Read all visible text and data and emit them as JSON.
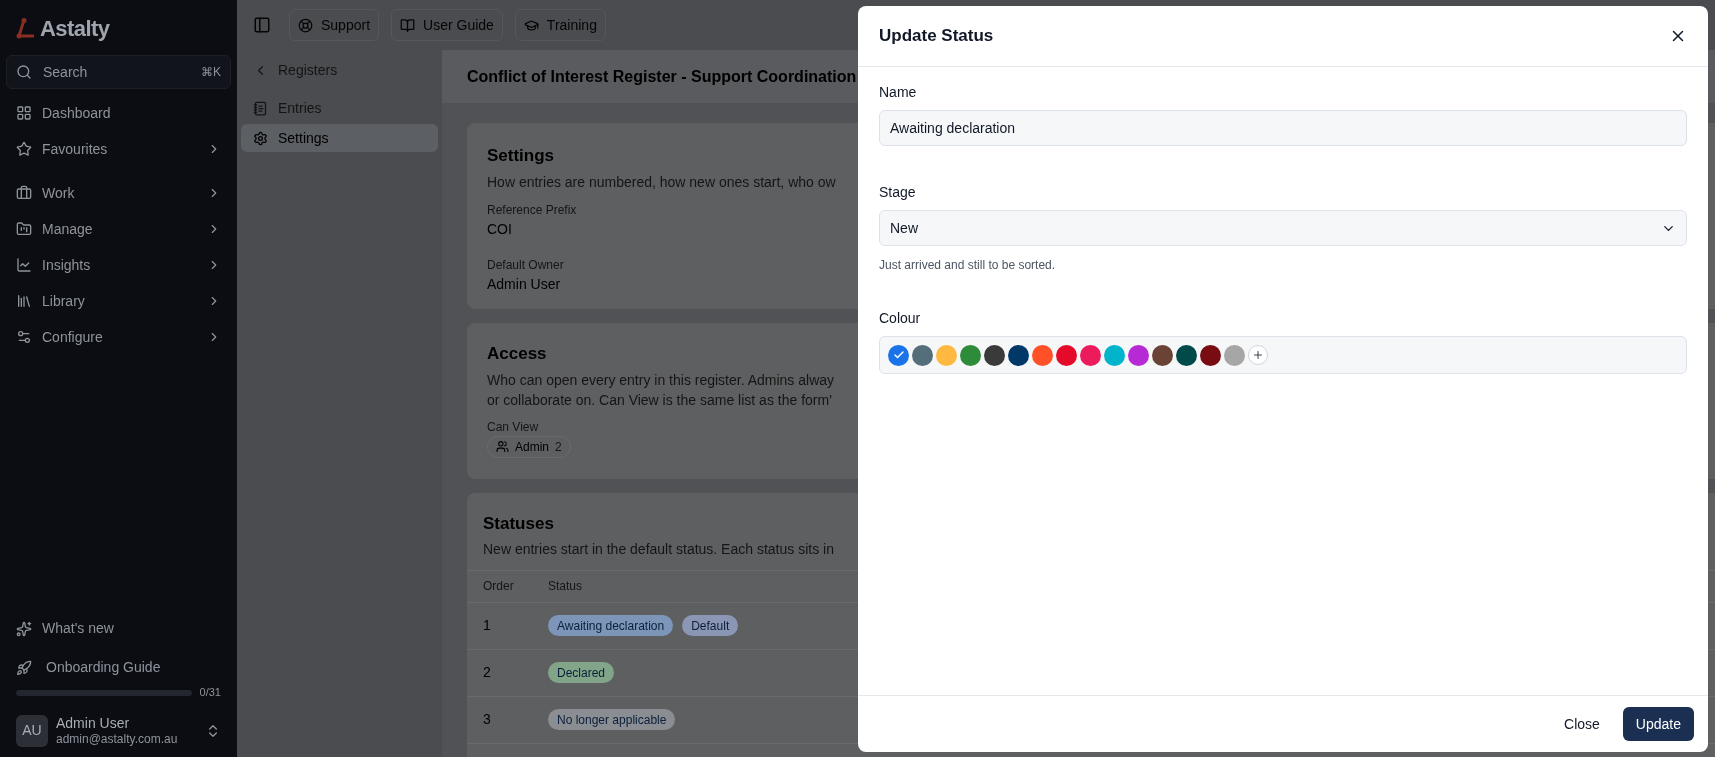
{
  "sidebar": {
    "logo": "Astalty",
    "search": {
      "placeholder": "Search",
      "shortcut": "⌘K"
    },
    "items": [
      {
        "kind": "link",
        "label": "Dashboard"
      },
      {
        "kind": "group",
        "label": "Favourites"
      },
      {
        "kind": "group",
        "label": "Work"
      },
      {
        "kind": "group",
        "label": "Manage"
      },
      {
        "kind": "group",
        "label": "Insights"
      },
      {
        "kind": "group",
        "label": "Library"
      },
      {
        "kind": "group",
        "label": "Configure"
      }
    ],
    "whats_new": "What's new",
    "onboarding": {
      "label": "Onboarding Guide",
      "level": 0,
      "count": "0/31"
    },
    "user": {
      "initials": "AU",
      "name": "Admin User",
      "email": "admin@astalty.com.au"
    }
  },
  "topbar": {
    "links": [
      "Support",
      "User Guide",
      "Training"
    ]
  },
  "register_nav": {
    "back": "Registers",
    "items": [
      {
        "label": "Entries",
        "selected": false
      },
      {
        "label": "Settings",
        "selected": true
      }
    ]
  },
  "page_title": "Conflict of Interest Register - Support Coordination",
  "settings_card": {
    "title": "Settings",
    "description": "How entries are numbered, how new ones start, who ow",
    "fields": [
      {
        "label": "Reference Prefix",
        "value": "COI"
      },
      {
        "label": "Default Owner",
        "value": "Admin User"
      }
    ]
  },
  "access_card": {
    "title": "Access",
    "description": "Who can open every entry in this register. Admins alway",
    "description_2": "or collaborate on. Can View is the same list as the form'",
    "can_view_label": "Can View",
    "group": {
      "name": "Admin",
      "count": "2"
    }
  },
  "statuses_card": {
    "title": "Statuses",
    "description": "New entries start in the default status. Each status sits in",
    "columns": [
      "Order",
      "Status"
    ],
    "rows": [
      {
        "order": "1",
        "badges": [
          {
            "label": "Awaiting declaration",
            "color": "#7d95b8"
          },
          {
            "label": "Default",
            "color": "#8a96b3"
          }
        ]
      },
      {
        "order": "2",
        "badges": [
          {
            "label": "Declared",
            "color": "#82a589"
          }
        ]
      },
      {
        "order": "3",
        "badges": [
          {
            "label": "No longer applicable",
            "color": "#8a8d92"
          }
        ]
      }
    ]
  },
  "dialog": {
    "title": "Update Status",
    "name_label": "Name",
    "name_value": "Awaiting declaration",
    "stage_label": "Stage",
    "stage_value": "New",
    "stage_hint": "Just arrived and still to be sorted.",
    "colour_label": "Colour",
    "colours": [
      {
        "color": "#1a73e8",
        "selected": true
      },
      {
        "color": "#546e7a",
        "selected": false
      },
      {
        "color": "#ffb940",
        "selected": false
      },
      {
        "color": "#2e8b3a",
        "selected": false
      },
      {
        "color": "#3a3a3a",
        "selected": false
      },
      {
        "color": "#003868",
        "selected": false
      },
      {
        "color": "#ff5128",
        "selected": false
      },
      {
        "color": "#e60a2a",
        "selected": false
      },
      {
        "color": "#ec1c5c",
        "selected": false
      },
      {
        "color": "#00b4cc",
        "selected": false
      },
      {
        "color": "#b62ad6",
        "selected": false
      },
      {
        "color": "#6b4336",
        "selected": false
      },
      {
        "color": "#004a4a",
        "selected": false
      },
      {
        "color": "#780c10",
        "selected": false
      },
      {
        "color": "#a6a6a6",
        "selected": false
      }
    ],
    "buttons": [
      "Close",
      "Update"
    ]
  }
}
